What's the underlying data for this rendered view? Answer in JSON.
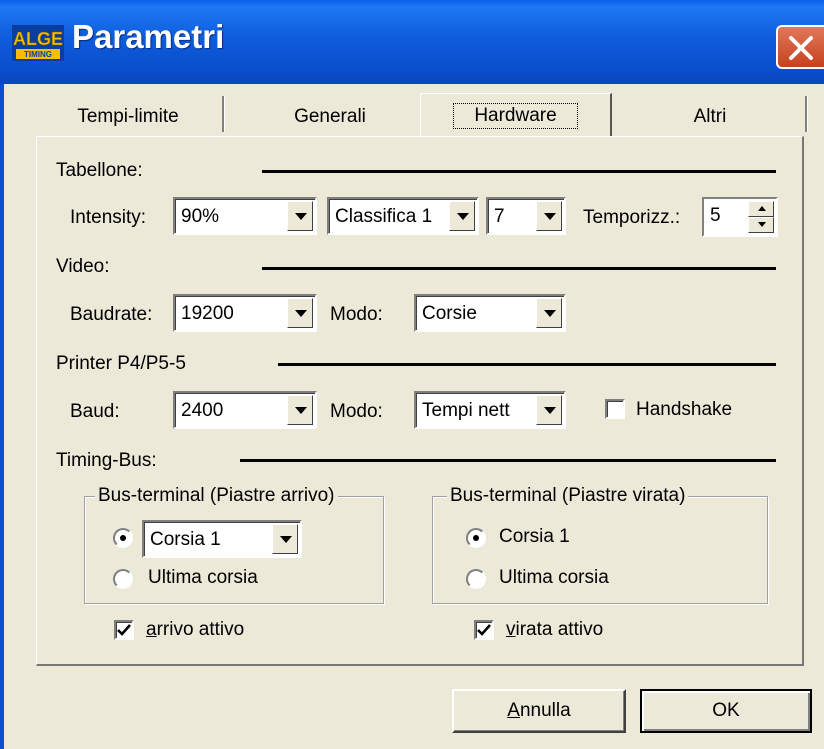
{
  "window": {
    "title": "Parametri",
    "logo_text_top": "ALGE",
    "logo_text_bottom": "TIMING"
  },
  "tabs": [
    {
      "label": "Tempi-limite"
    },
    {
      "label": "Generali"
    },
    {
      "label": "Hardware",
      "selected": true
    },
    {
      "label": "Altri"
    }
  ],
  "tabellone": {
    "section_label": "Tabellone:",
    "intensity_label": "Intensity:",
    "intensity_value": "90%",
    "mode_value": "Classifica 1",
    "number_value": "7",
    "temporizz_label": "Temporizz.:",
    "temporizz_value": "5"
  },
  "video": {
    "section_label": "Video:",
    "baudrate_label": "Baudrate:",
    "baudrate_value": "19200",
    "modo_label": "Modo:",
    "modo_value": "Corsie"
  },
  "printer": {
    "section_label": "Printer P4/P5-5",
    "baud_label": "Baud:",
    "baud_value": "2400",
    "modo_label": "Modo:",
    "modo_value": "Tempi nett",
    "handshake_label": "Handshake",
    "handshake_checked": false
  },
  "timing_bus": {
    "section_label": "Timing-Bus:",
    "arrivo": {
      "group_title": "Bus-terminal (Piastre arrivo)",
      "option1_value": "Corsia 1",
      "option2_label": "Ultima corsia",
      "selected": 1,
      "active_prefix": "a",
      "active_rest": "rrivo attivo",
      "active_checked": true
    },
    "virata": {
      "group_title": "Bus-terminal (Piastre virata)",
      "option1_label": "Corsia 1",
      "option2_label": "Ultima corsia",
      "selected": 1,
      "active_prefix": "v",
      "active_rest": "irata attivo",
      "active_checked": true
    }
  },
  "buttons": {
    "cancel_prefix": "A",
    "cancel_rest": "nnulla",
    "ok_label": "OK"
  },
  "colors": {
    "titlebar": "#0a5ee8",
    "close": "#d4502a",
    "dialog_bg": "#ece9d8"
  }
}
